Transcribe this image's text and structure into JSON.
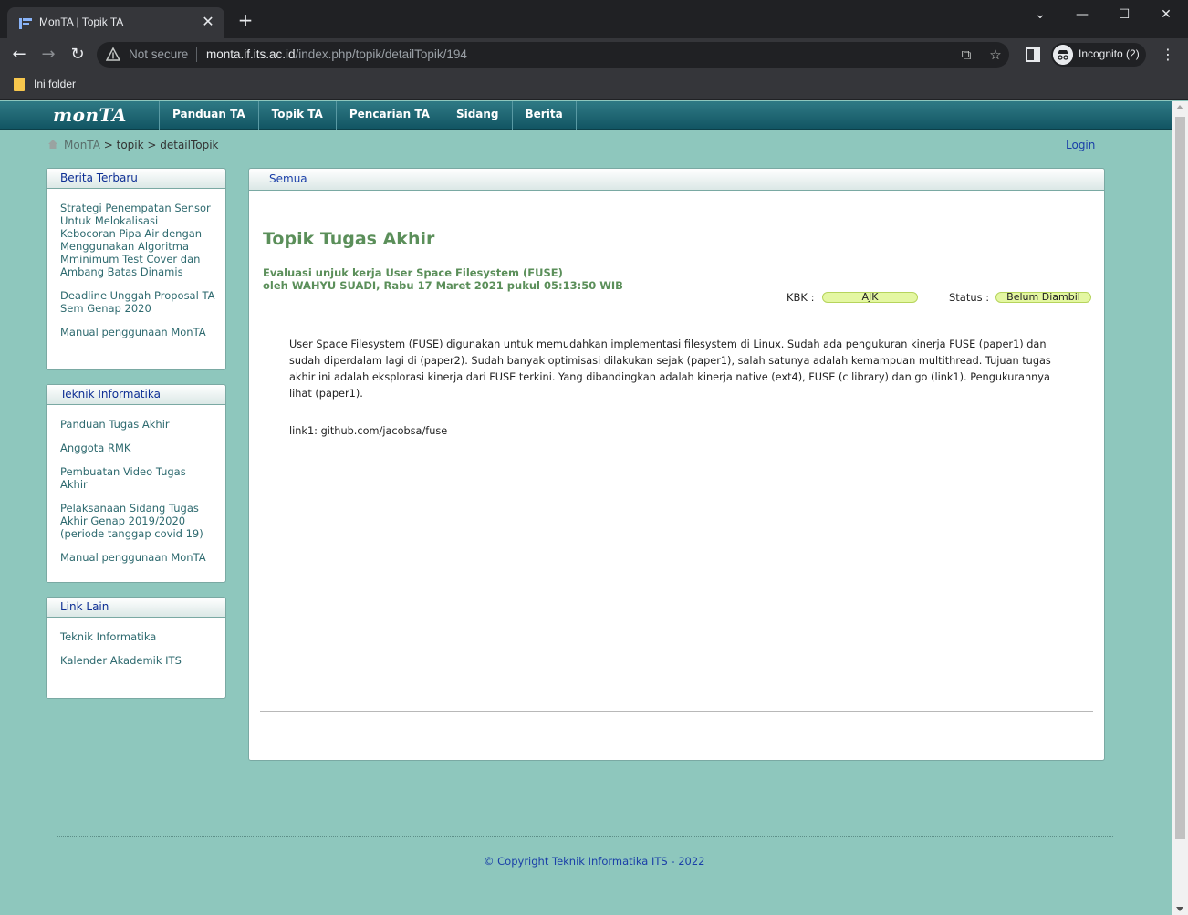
{
  "browser": {
    "tab_title": "MonTA | Topik TA",
    "tab_close": "✕",
    "new_tab": "+",
    "window_controls": [
      "⌄",
      "—",
      "☐",
      "✕"
    ],
    "security_label": "Not secure",
    "url_host": "monta.if.its.ac.id",
    "url_path": "/index.php/topik/detailTopik/194",
    "incognito_label": "Incognito (2)",
    "bookmark_folder": "Ini folder"
  },
  "nav": {
    "logo": "monTA",
    "items": [
      "Panduan TA",
      "Topik TA",
      "Pencarian TA",
      "Sidang",
      "Berita"
    ]
  },
  "breadcrumb": {
    "root": "MonTA",
    "sep1": " > ",
    "level1": "topik",
    "sep2": " > ",
    "level2": "detailTopik"
  },
  "login": "Login",
  "sidebar": {
    "berita": {
      "title": "Berita Terbaru",
      "links": [
        "Strategi Penempatan Sensor Untuk Melokalisasi Kebocoran Pipa Air dengan Menggunakan Algoritma Mminimum Test Cover dan Ambang Batas Dinamis",
        "Deadline Unggah Proposal TA Sem Genap 2020",
        "Manual penggunaan MonTA"
      ]
    },
    "teknik": {
      "title": "Teknik Informatika",
      "links": [
        "Panduan Tugas Akhir",
        "Anggota RMK",
        "Pembuatan Video Tugas Akhir",
        "Pelaksanaan Sidang Tugas Akhir Genap 2019/2020 (periode tanggap covid 19)",
        "Manual penggunaan MonTA"
      ]
    },
    "linklain": {
      "title": "Link Lain",
      "links": [
        "Teknik Informatika",
        "Kalender Akademik ITS"
      ]
    }
  },
  "content": {
    "tab": "Semua",
    "title": "Topik Tugas Akhir",
    "topic": "Evaluasi unjuk kerja User Space Filesystem (FUSE)",
    "byline": "oleh WAHYU SUADI, Rabu 17 Maret 2021 pukul 05:13:50 WIB",
    "kbk_label": "KBK :",
    "kbk_value": "AJK",
    "status_label": "Status :",
    "status_value": "Belum Diambil",
    "description": "User Space Filesystem (FUSE) digunakan untuk memudahkan implementasi filesystem di Linux. Sudah ada pengukuran kinerja FUSE (paper1) dan sudah diperdalam lagi di (paper2). Sudah banyak optimisasi dilakukan sejak (paper1), salah satunya adalah kemampuan multithread. Tujuan tugas akhir ini adalah eksplorasi kinerja dari FUSE terkini. Yang dibandingkan adalah kinerja native (ext4), FUSE (c library) dan go (link1). Pengukurannya lihat (paper1).",
    "link1": "link1: github.com/jacobsa/fuse"
  },
  "footer": "© Copyright Teknik Informatika ITS - 2022",
  "colors": {
    "page_bg": "#8ec7bd",
    "navbar": "#125563",
    "heading_green": "#5b8f5a",
    "link_blue": "#1a3fa8",
    "badge": "#e4f7a2"
  }
}
